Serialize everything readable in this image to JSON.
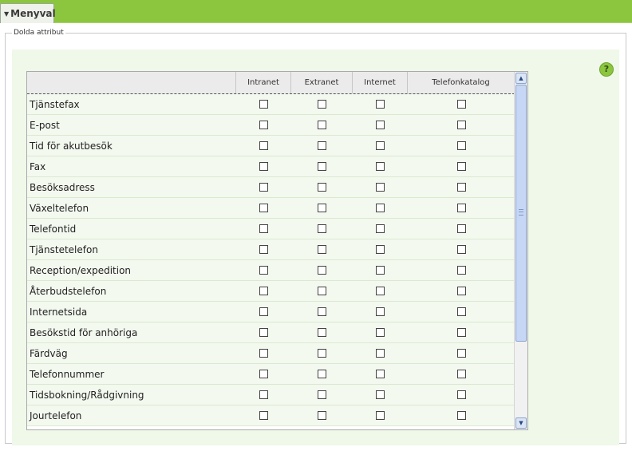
{
  "menu": {
    "label": "Menyval",
    "icon": "triangle-down-icon"
  },
  "panel": {
    "legend": "Dolda attribut",
    "help_icon_text": "?"
  },
  "table": {
    "columns": [
      "Intranet",
      "Extranet",
      "Internet",
      "Telefonkatalog"
    ],
    "rows": [
      {
        "label": "Tjänstefax",
        "checked": [
          false,
          false,
          false,
          false
        ]
      },
      {
        "label": "E-post",
        "checked": [
          false,
          false,
          false,
          false
        ]
      },
      {
        "label": "Tid för akutbesök",
        "checked": [
          false,
          false,
          false,
          false
        ]
      },
      {
        "label": "Fax",
        "checked": [
          false,
          false,
          false,
          false
        ]
      },
      {
        "label": "Besöksadress",
        "checked": [
          false,
          false,
          false,
          false
        ]
      },
      {
        "label": "Växeltelefon",
        "checked": [
          false,
          false,
          false,
          false
        ]
      },
      {
        "label": "Telefontid",
        "checked": [
          false,
          false,
          false,
          false
        ]
      },
      {
        "label": "Tjänstetelefon",
        "checked": [
          false,
          false,
          false,
          false
        ]
      },
      {
        "label": "Reception/expedition",
        "checked": [
          false,
          false,
          false,
          false
        ]
      },
      {
        "label": "Återbudstelefon",
        "checked": [
          false,
          false,
          false,
          false
        ]
      },
      {
        "label": "Internetsida",
        "checked": [
          false,
          false,
          false,
          false
        ]
      },
      {
        "label": "Besökstid för anhöriga",
        "checked": [
          false,
          false,
          false,
          false
        ]
      },
      {
        "label": "Färdväg",
        "checked": [
          false,
          false,
          false,
          false
        ]
      },
      {
        "label": "Telefonnummer",
        "checked": [
          false,
          false,
          false,
          false
        ]
      },
      {
        "label": "Tidsbokning/Rådgivning",
        "checked": [
          false,
          false,
          false,
          false
        ]
      },
      {
        "label": "Jourtelefon",
        "checked": [
          false,
          false,
          false,
          false
        ]
      }
    ]
  },
  "colors": {
    "topbar": "#8cc63f",
    "panel_bg": "#eff8e9",
    "row_bg": "#f3f9ef"
  }
}
